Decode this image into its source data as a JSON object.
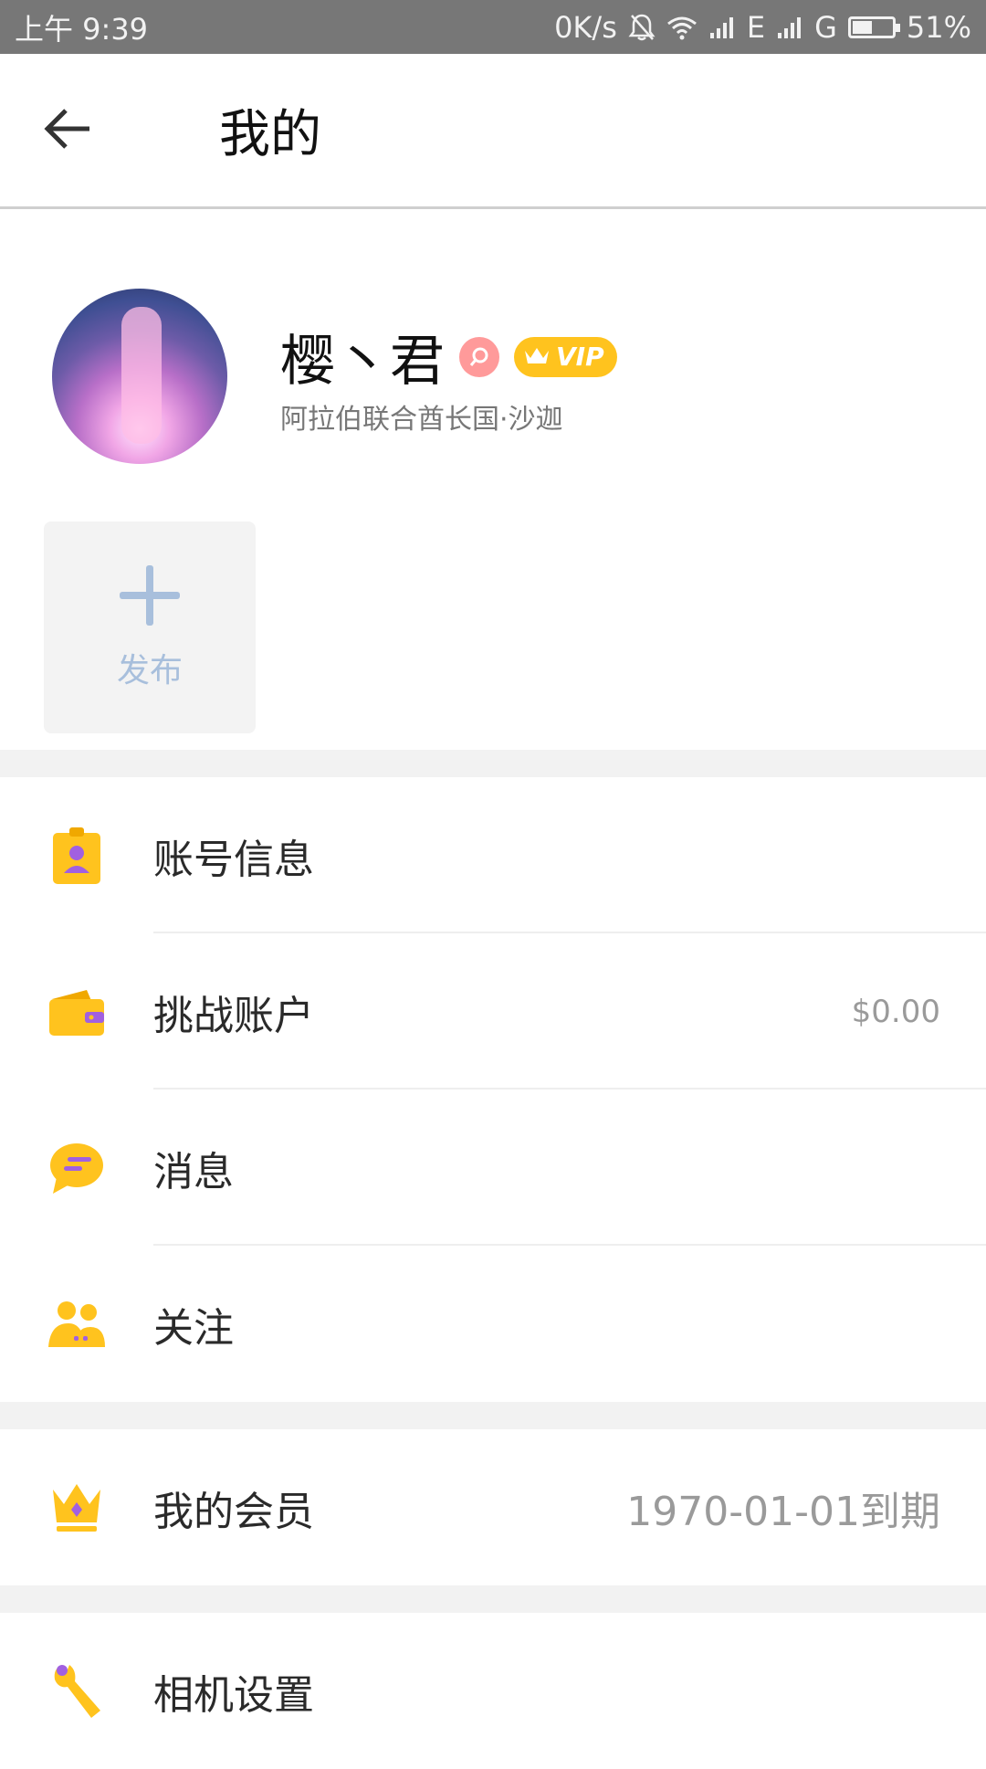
{
  "status_bar": {
    "time": "上午 9:39",
    "net_speed": "0K/s",
    "network1": "E",
    "network2": "G",
    "battery": "51%",
    "battery_level": 0.51
  },
  "header": {
    "title": "我的",
    "back_icon": "arrow-left-icon"
  },
  "profile": {
    "name": "樱丶君",
    "vip_label": "VIP",
    "location": "阿拉伯联合酋长国·沙迦"
  },
  "publish": {
    "label": "发布"
  },
  "menu": {
    "account_info": {
      "label": "账号信息"
    },
    "challenge_account": {
      "label": "挑战账户",
      "value": "$0.00"
    },
    "messages": {
      "label": "消息"
    },
    "follow": {
      "label": "关注"
    },
    "membership": {
      "label": "我的会员",
      "value": "1970-01-01到期"
    },
    "camera_settings": {
      "label": "相机设置"
    }
  },
  "colors": {
    "accent_yellow": "#FFC31E",
    "accent_purple": "#A160E0",
    "publish_blue": "#A8BFDC",
    "status_bar": "#777777"
  }
}
